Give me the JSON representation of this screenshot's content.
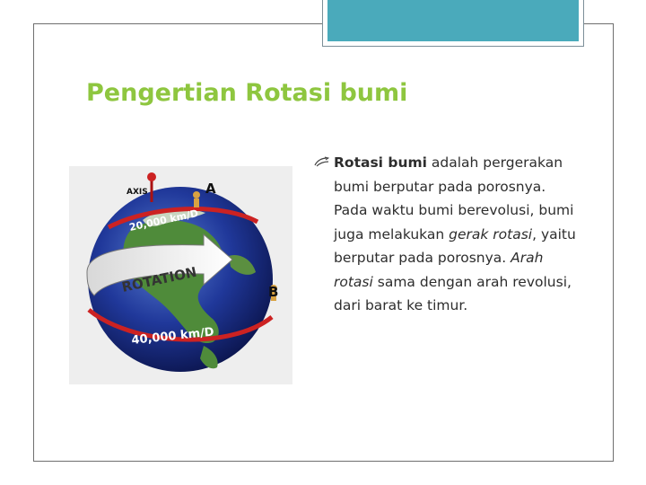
{
  "slide": {
    "title": "Pengertian Rotasi bumi",
    "paragraph": {
      "lead_bold": "Rotasi bumi",
      "part1": " adalah pergerakan bumi berputar pada porosnya. Pada waktu bumi berevolusi, bumi juga melakukan ",
      "italic1": "gerak rotasi",
      "part2": ", yaitu berputar pada porosnya. ",
      "italic2": "Arah rotasi",
      "part3": " sama dengan arah revolusi, dari barat ke timur."
    }
  },
  "figure": {
    "axis_label": "AXIS",
    "point_a": "A",
    "point_b": "B",
    "speed_top": "20,000 km/D",
    "speed_bottom": "40,000 km/D",
    "rotation_label": "ROTATION"
  },
  "colors": {
    "title": "#8ec63f",
    "tab": "#4aaabb",
    "text": "#2d2d2d"
  }
}
